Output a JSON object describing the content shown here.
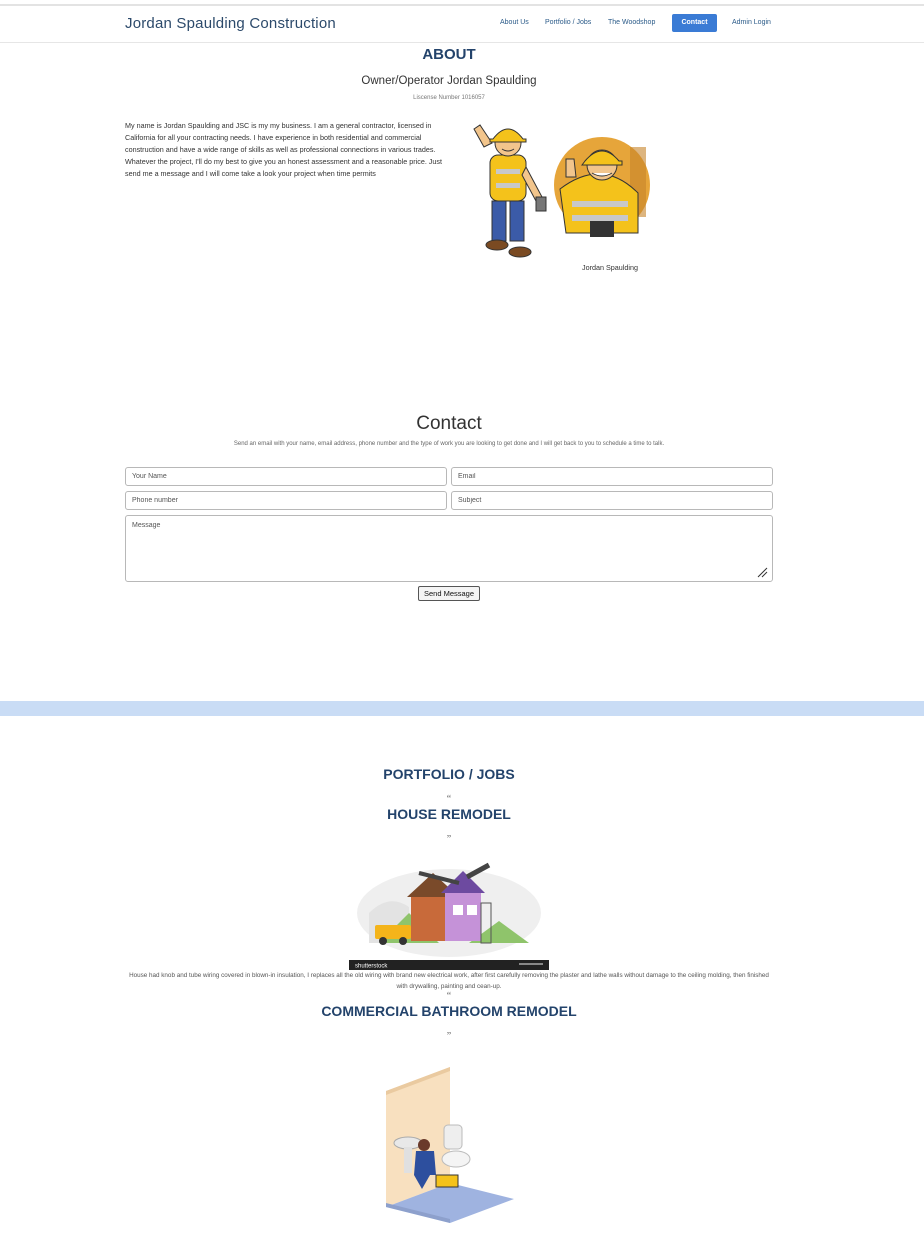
{
  "nav": {
    "brand": "Jordan Spaulding Construction",
    "links": [
      "About Us",
      "Portfolio / Jobs",
      "The Woodshop",
      "Contact",
      "Admin Login"
    ],
    "active": "Contact",
    "accent": "#3a7bd5"
  },
  "about": {
    "title": "ABOUT",
    "subtitle": "Owner/Operator Jordan Spaulding",
    "license": "Liscense Number 1016057",
    "body": "My name is Jordan Spaulding and JSC is my my business. I am a general contractor, licensed in California for all your contracting needs. I have experience in both residential and commercial construction and have a wide range of skills as well as professional connections in various trades. Whatever the project, I'll do my best to give you an honest assessment and a reasonable price. Just send me a message and I will come take a look your project when time permits",
    "caption": "Jordan Spaulding"
  },
  "contact": {
    "title": "Contact",
    "description": "Send an email with your name, email address, phone number and the type of work you are looking to get done and I will get back to you to schedule a time to talk.",
    "fields": {
      "name": "Your Name",
      "email": "Email",
      "phone": "Phone number",
      "subject": "Subject",
      "message": "Message"
    },
    "submit": "Send Message"
  },
  "portfolio": {
    "title": "PORTFOLIO / JOBS",
    "open_quote": "“",
    "close_quote": "”",
    "jobs": [
      {
        "title": "HOUSE REMODEL",
        "image_watermark": "shutterstock",
        "description": "House had knob and tube wiring covered in blown-in insulation, I replaces all the old wiring with brand new electrical work, after first carefully removing the plaster and lathe walls without damage to the ceiling molding, then finished with drywalling, painting and cean-up."
      },
      {
        "title": "COMMERCIAL BATHROOM REMODEL"
      }
    ]
  },
  "colors": {
    "heading": "#23436b",
    "band": "#c9dcf5"
  }
}
